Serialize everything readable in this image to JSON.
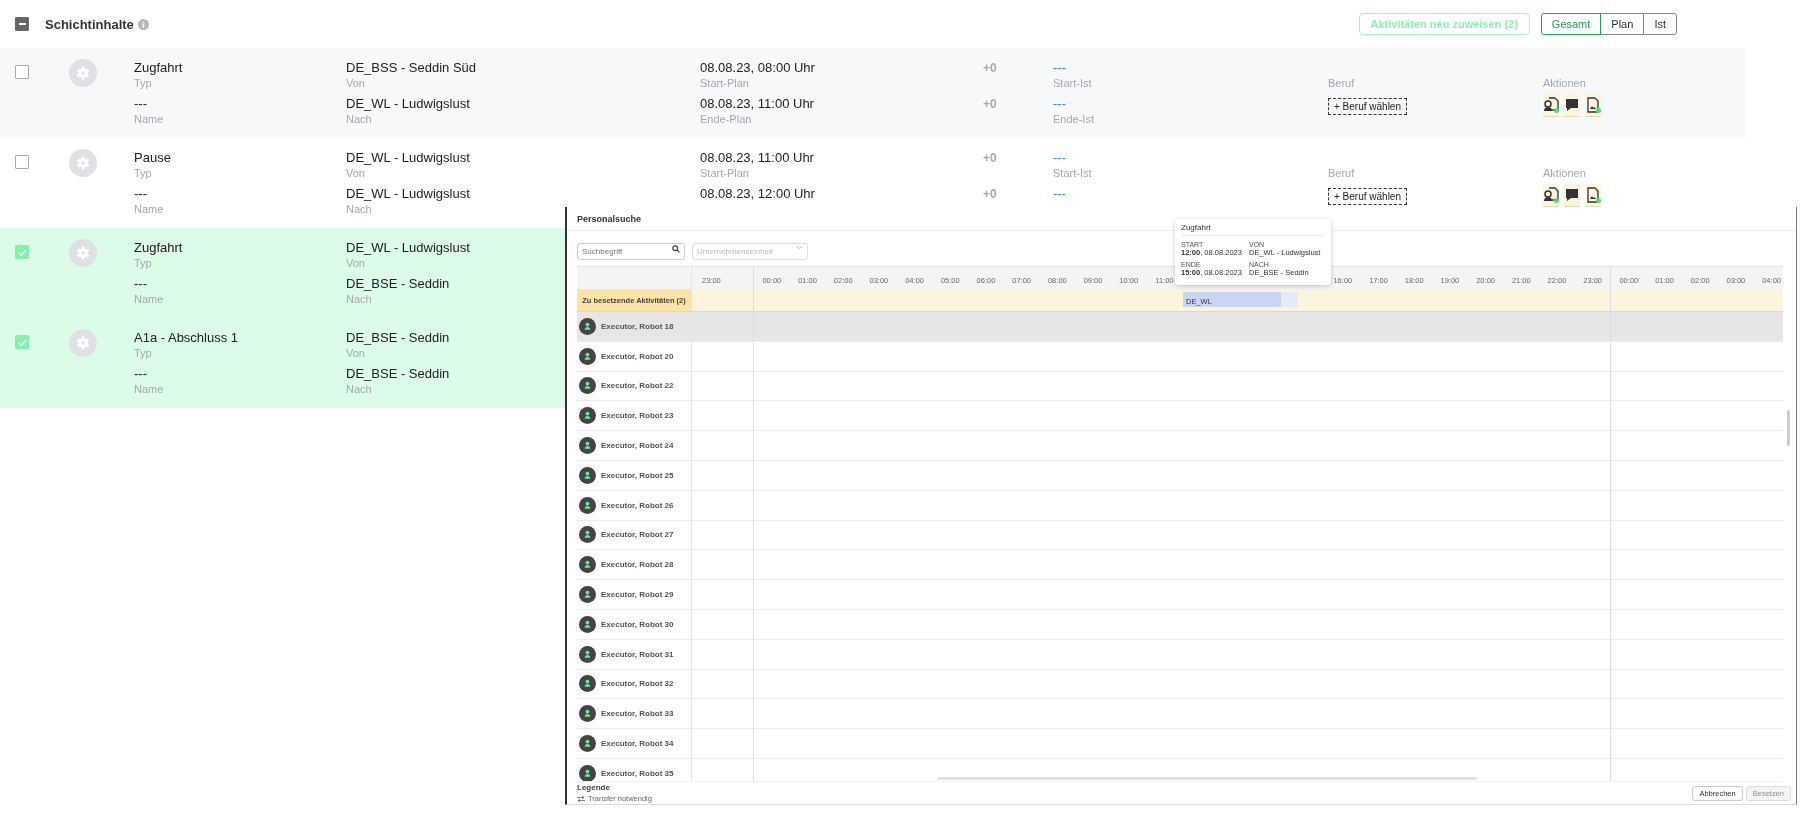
{
  "header": {
    "select_all": {
      "indeterminate": true
    },
    "title": "Schichtinhalte",
    "reassign_button": {
      "label": "Aktivitäten neu zuweisen (2)",
      "disabled": true
    },
    "view_toggle": [
      {
        "label": "Gesamt",
        "selected": true
      },
      {
        "label": "Plan",
        "selected": false
      },
      {
        "label": "Ist",
        "selected": false
      }
    ]
  },
  "rows": [
    {
      "checked": false,
      "type": {
        "value": "Zugfahrt",
        "label": "Typ"
      },
      "name": {
        "value": "---",
        "label": "Name"
      },
      "from": {
        "value": "DE_BSS - Seddin Süd",
        "label": "Von"
      },
      "to": {
        "value": "DE_WL - Ludwigslust",
        "label": "Nach"
      },
      "start_plan": {
        "value": "08.08.23, 08:00 Uhr",
        "label": "Start-Plan"
      },
      "end_plan": {
        "value": "08.08.23, 11:00 Uhr",
        "label": "Ende-Plan"
      },
      "start_delta": "+0",
      "end_delta": "+0",
      "start_ist": {
        "value": "---",
        "label": "Start-Ist"
      },
      "end_ist": {
        "value": "---",
        "label": "Ende-Ist"
      },
      "profession": {
        "label": "Beruf",
        "button": "+ Beruf wählen"
      },
      "actions": {
        "label": "Aktionen"
      }
    },
    {
      "checked": false,
      "type": {
        "value": "Pause",
        "label": "Typ"
      },
      "name": {
        "value": "---",
        "label": "Name"
      },
      "from": {
        "value": "DE_WL - Ludwigslust",
        "label": "Von"
      },
      "to": {
        "value": "DE_WL - Ludwigslust",
        "label": "Nach"
      },
      "start_plan": {
        "value": "08.08.23, 11:00 Uhr",
        "label": "Start-Plan"
      },
      "end_plan": {
        "value": "08.08.23, 12:00 Uhr"
      },
      "start_delta": "+0",
      "end_delta": "+0",
      "start_ist": {
        "value": "---",
        "label": "Start-Ist"
      },
      "end_ist": {
        "value": "---"
      },
      "profession": {
        "label": "Beruf",
        "button": "+ Beruf wählen"
      },
      "actions": {
        "label": "Aktionen"
      }
    },
    {
      "checked": true,
      "type": {
        "value": "Zugfahrt",
        "label": "Typ"
      },
      "name": {
        "value": "---",
        "label": "Name"
      },
      "from": {
        "value": "DE_WL - Ludwigslust",
        "label": "Von"
      },
      "to": {
        "value": "DE_BSE - Seddin",
        "label": "Nach"
      }
    },
    {
      "checked": true,
      "type": {
        "value": "A1a - Abschluss 1",
        "label": "Typ"
      },
      "name": {
        "value": "---",
        "label": "Name"
      },
      "from": {
        "value": "DE_BSE - Seddin",
        "label": "Von"
      },
      "to": {
        "value": "DE_BSE - Seddin",
        "label": "Nach"
      }
    }
  ],
  "dialog": {
    "title": "Personalsuche",
    "search": {
      "placeholder": "Suchbegriff"
    },
    "unit_select": {
      "placeholder": "Unternehmenseinheit"
    },
    "timeline": {
      "days": [
        {
          "hours": [
            "23:00"
          ]
        },
        {
          "hours": [
            "00:00",
            "01:00",
            "02:00",
            "03:00",
            "04:00",
            "05:00",
            "06:00",
            "07:00",
            "08:00",
            "09:00",
            "10:00",
            "11:00"
          ],
          "hours_after": [
            "16:00",
            "17:00",
            "18:00",
            "19:00",
            "20:00",
            "21:00",
            "22:00",
            "23:00"
          ]
        },
        {
          "hours": [
            "00:00",
            "01:00",
            "02:00",
            "03:00",
            "04:00"
          ]
        }
      ],
      "open_activities": {
        "label": "Zu besetzende Aktivitäten (2)",
        "bar": "DE_WL"
      },
      "executors": [
        {
          "name": "Executor, Robot 18",
          "selected": true
        },
        {
          "name": "Executor, Robot 20",
          "selected": false
        },
        {
          "name": "Executor, Robot 22",
          "selected": false
        },
        {
          "name": "Executor, Robot 23",
          "selected": false
        },
        {
          "name": "Executor, Robot 24",
          "selected": false
        },
        {
          "name": "Executor, Robot 25",
          "selected": false
        },
        {
          "name": "Executor, Robot 26",
          "selected": false
        },
        {
          "name": "Executor, Robot 27",
          "selected": false
        },
        {
          "name": "Executor, Robot 28",
          "selected": false
        },
        {
          "name": "Executor, Robot 29",
          "selected": false
        },
        {
          "name": "Executor, Robot 30",
          "selected": false
        },
        {
          "name": "Executor, Robot 31",
          "selected": false
        },
        {
          "name": "Executor, Robot 32",
          "selected": false
        },
        {
          "name": "Executor, Robot 33",
          "selected": false
        },
        {
          "name": "Executor, Robot 34",
          "selected": false
        },
        {
          "name": "Executor, Robot 35",
          "selected": false
        }
      ]
    },
    "tooltip": {
      "title": "Zugfahrt",
      "start_label": "START",
      "start": "**12:00**, 08.08.2023",
      "from_label": "VON",
      "from": "DE_WL - Ludwigslust",
      "end_label": "ENDE",
      "end": "**15:00**, 08.08.2023",
      "to_label": "NACH",
      "to": "DE_BSE - Seddin"
    },
    "legend": {
      "title": "Legende",
      "items": [
        "Transfer notwendig"
      ]
    },
    "buttons": [
      {
        "label": "Abbrechen",
        "disabled": false
      },
      {
        "label": "Besetzen",
        "disabled": true
      }
    ]
  }
}
